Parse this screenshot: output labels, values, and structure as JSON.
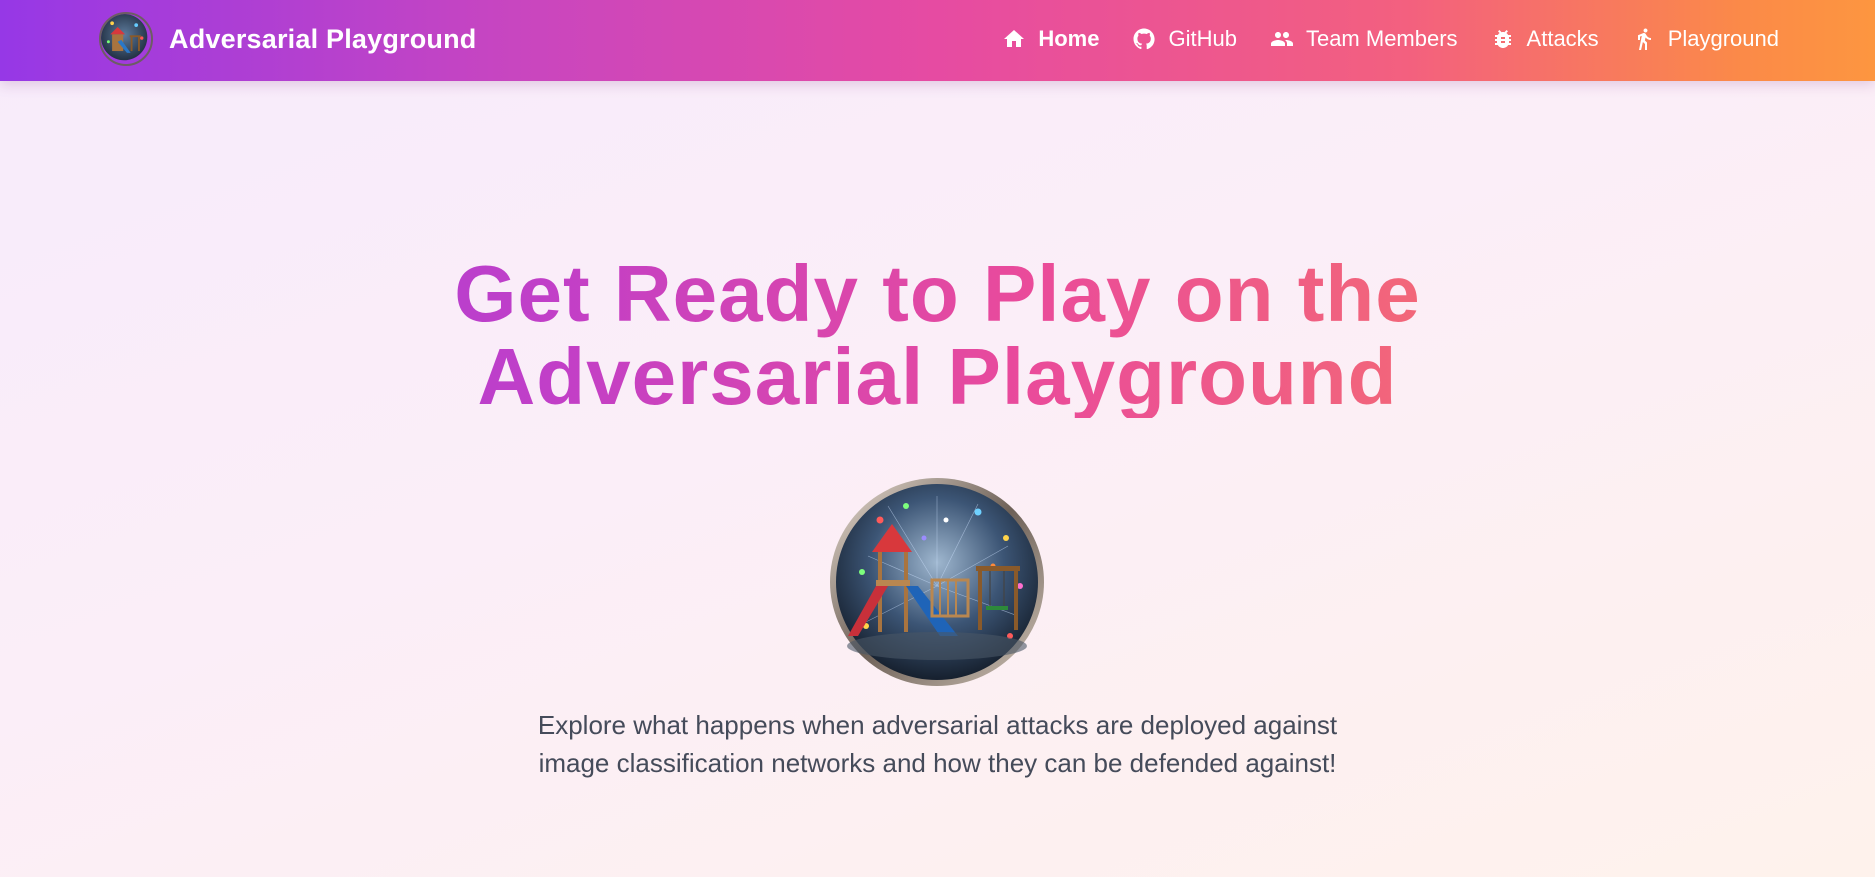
{
  "navbar": {
    "brand_title": "Adversarial Playground",
    "links": [
      {
        "label": "Home",
        "icon": "home-icon",
        "active": true
      },
      {
        "label": "GitHub",
        "icon": "github-icon",
        "active": false
      },
      {
        "label": "Team Members",
        "icon": "people-icon",
        "active": false
      },
      {
        "label": "Attacks",
        "icon": "bug-icon",
        "active": false
      },
      {
        "label": "Playground",
        "icon": "running-person-icon",
        "active": false
      }
    ]
  },
  "hero": {
    "title": "Get Ready to Play on the Adversarial Playground",
    "description": "Explore what happens when adversarial attacks are deployed against image classification networks and how they can be defended against!"
  },
  "colors": {
    "nav_gradient_start": "#9638e6",
    "nav_gradient_mid": "#e64ba2",
    "nav_gradient_end": "#fd9640",
    "title_gradient_start": "#9a3fe0",
    "title_gradient_end": "#f9884f",
    "body_text": "#454b5a"
  }
}
